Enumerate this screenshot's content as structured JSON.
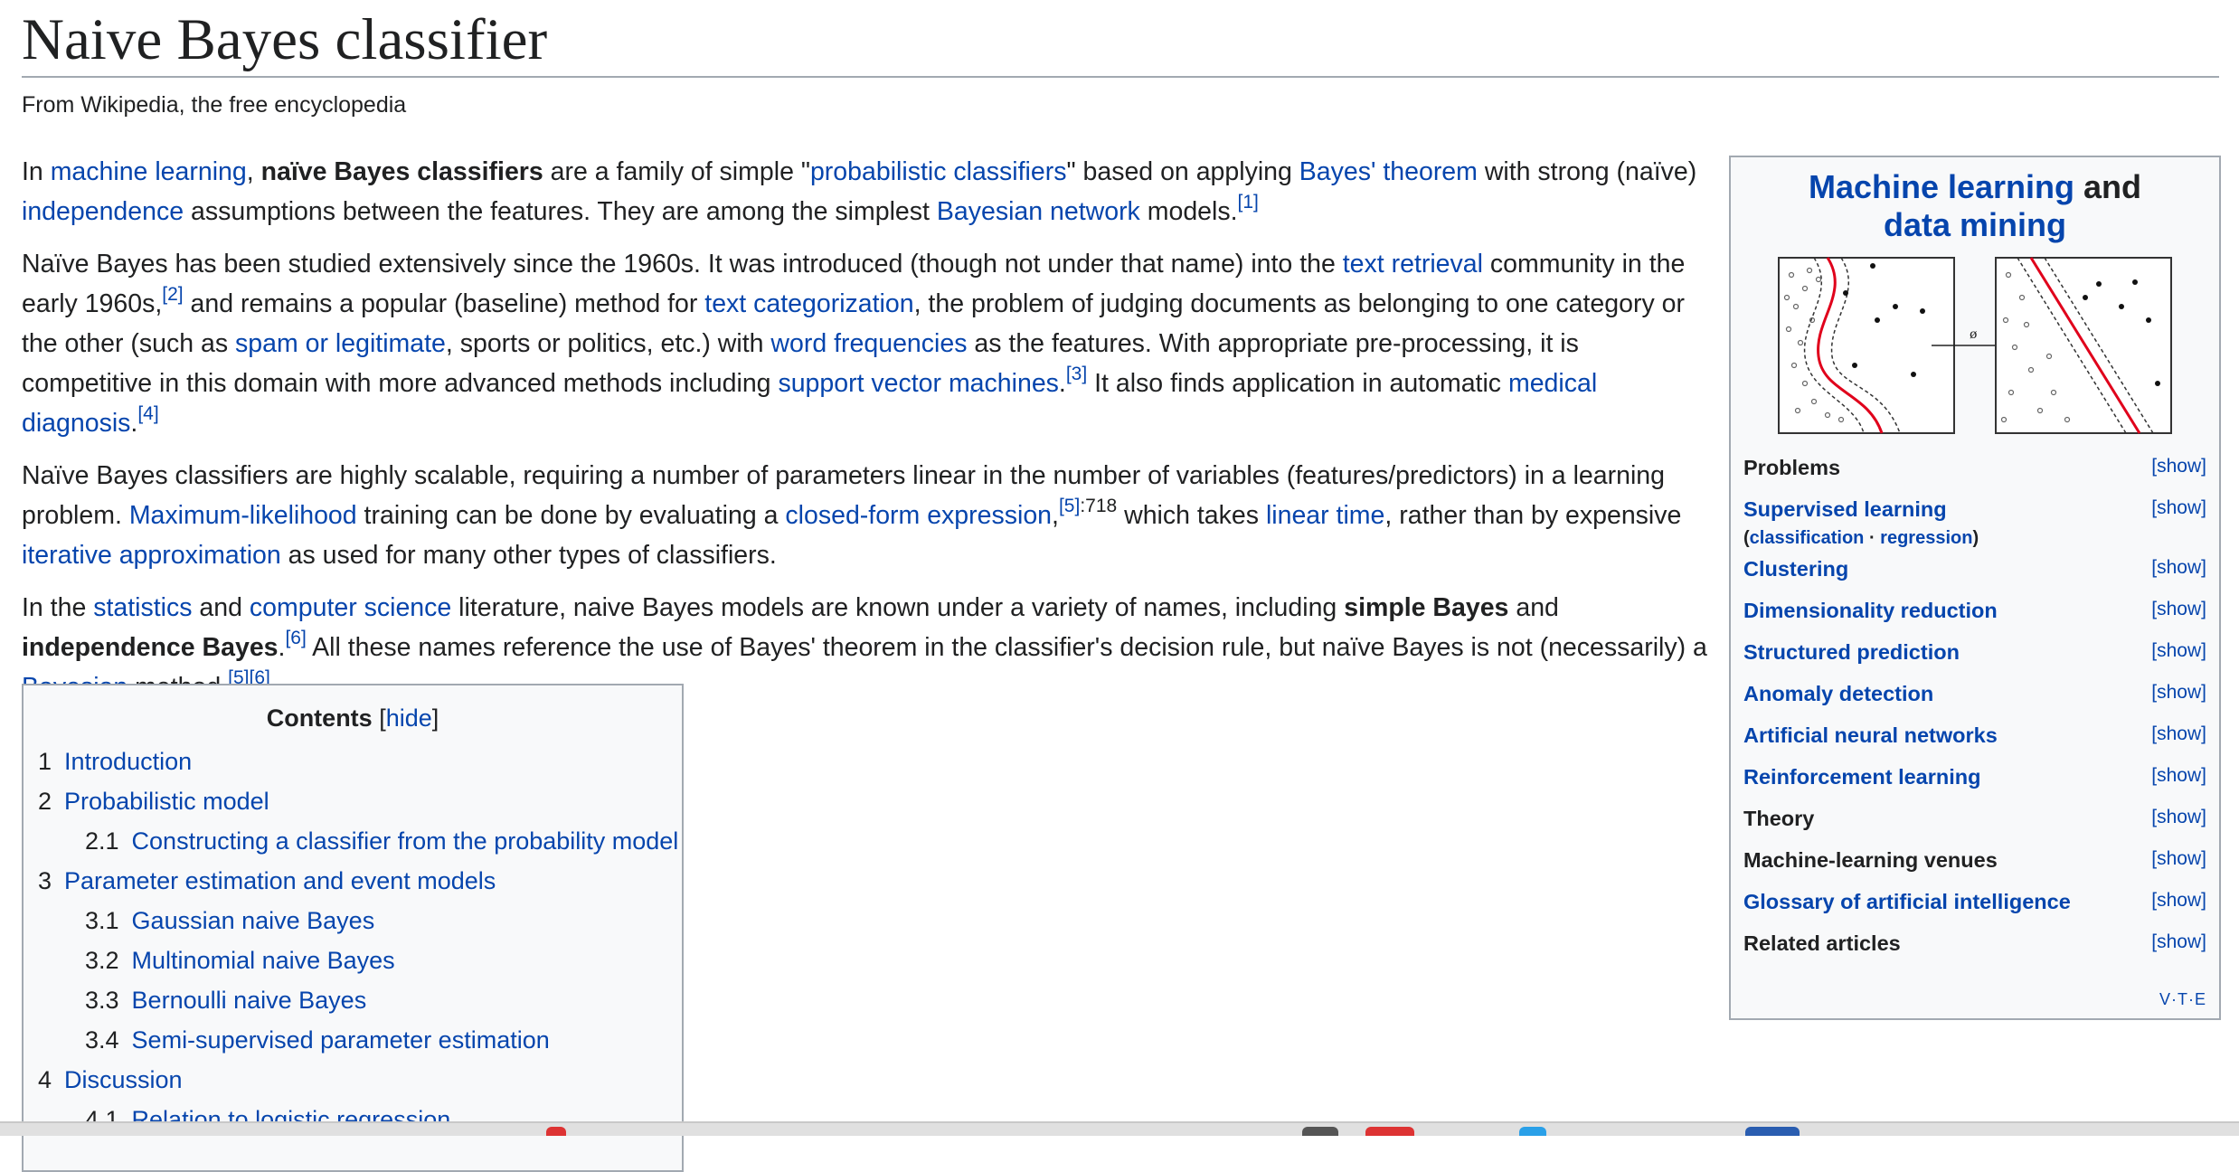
{
  "page": {
    "title": "Naive Bayes classifier",
    "tagline": "From Wikipedia, the free encyclopedia"
  },
  "p1": {
    "t1": "In ",
    "l1": "machine learning",
    "t2": ", ",
    "b1": "naïve Bayes classifiers",
    "t3": " are a family of simple \"",
    "l2": "probabilistic classifiers",
    "t4": "\" based on applying ",
    "l3": "Bayes' theorem",
    "t5": " with strong (naïve) ",
    "l4": "independence",
    "t6": " assumptions between the features. They are among the simplest ",
    "l5": "Bayesian network",
    "t7": " models.",
    "r1": "[1]"
  },
  "p2": {
    "t1": "Naïve Bayes has been studied extensively since the 1960s. It was introduced (though not under that name) into the ",
    "l1": "text retrieval",
    "t2": " community in the early 1960s,",
    "r1": "[2]",
    "t3": " and remains a popular (baseline) method for ",
    "l2": "text categorization",
    "t4": ", the problem of judging documents as belonging to one category or the other (such as ",
    "l3": "spam or legitimate",
    "t5": ", sports or politics, etc.) with ",
    "l4": "word frequencies",
    "t6": " as the features. With appropriate pre-processing, it is competitive in this domain with more advanced methods including ",
    "l5": "support vector machines",
    "t7": ".",
    "r2": "[3]",
    "t8": " It also finds application in automatic ",
    "l6": "medical diagnosis",
    "t9": ".",
    "r3": "[4]"
  },
  "p3": {
    "t1": "Naïve Bayes classifiers are highly scalable, requiring a number of parameters linear in the number of variables (features/predictors) in a learning problem. ",
    "l1": "Maximum-likelihood",
    "t2": " training can be done by evaluating a ",
    "l2": "closed-form expression",
    "t3": ",",
    "r1": "[5]",
    "r1b": ":718",
    "t4": " which takes ",
    "l3": "linear time",
    "t5": ", rather than by expensive ",
    "l4": "iterative approximation",
    "t6": " as used for many other types of classifiers."
  },
  "p4": {
    "t1": "In the ",
    "l1": "statistics",
    "t2": " and ",
    "l2": "computer science",
    "t3": " literature, naive Bayes models are known under a variety of names, including ",
    "b1": "simple Bayes",
    "t4": " and ",
    "b2": "independence Bayes",
    "t5": ".",
    "r1": "[6]",
    "t6": " All these names reference the use of Bayes' theorem in the classifier's decision rule, but naïve Bayes is not (necessarily) a ",
    "l3": "Bayesian",
    "t7": " method.",
    "r2": "[5][6]"
  },
  "toc": {
    "title": "Contents",
    "bracket_open": "[",
    "toggle": "hide",
    "bracket_close": "]",
    "items": [
      {
        "num": "1",
        "label": "Introduction"
      },
      {
        "num": "2",
        "label": "Probabilistic model"
      },
      {
        "num": "2.1",
        "label": "Constructing a classifier from the probability model"
      },
      {
        "num": "3",
        "label": "Parameter estimation and event models"
      },
      {
        "num": "3.1",
        "label": "Gaussian naive Bayes"
      },
      {
        "num": "3.2",
        "label": "Multinomial naive Bayes"
      },
      {
        "num": "3.3",
        "label": "Bernoulli naive Bayes"
      },
      {
        "num": "3.4",
        "label": "Semi-supervised parameter estimation"
      },
      {
        "num": "4",
        "label": "Discussion"
      },
      {
        "num": "4.1",
        "label": "Relation to logistic regression"
      }
    ]
  },
  "infobox": {
    "title_link1": "Machine learning",
    "title_and": " and",
    "title_link2": "data mining",
    "arrow_label": "ø",
    "show_label": "[show]",
    "rows": [
      {
        "label": "Problems"
      },
      {
        "label": "Supervised learning",
        "sub_open": "(",
        "sub1": "classification",
        "sub_sep": " · ",
        "sub2": "regression",
        "sub_close": ")"
      },
      {
        "label": "Clustering"
      },
      {
        "label": "Dimensionality reduction"
      },
      {
        "label": "Structured prediction"
      },
      {
        "label": "Anomaly detection"
      },
      {
        "label": "Artificial neural networks"
      },
      {
        "label": "Reinforcement learning"
      },
      {
        "label": "Theory"
      },
      {
        "label": "Machine-learning venues"
      },
      {
        "label": "Glossary of artificial intelligence"
      },
      {
        "label": "Related articles"
      }
    ],
    "vte": "V·T·E"
  },
  "colors": {
    "link": "#0645ad",
    "text": "#202122",
    "border": "#a2a9b1",
    "box_bg": "#f8f9fa",
    "curve": "#e0001b"
  }
}
